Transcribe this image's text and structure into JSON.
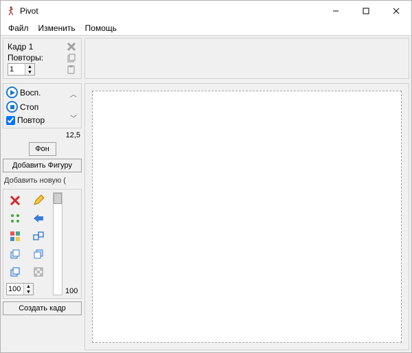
{
  "window": {
    "title": "Pivot"
  },
  "menu": {
    "file": "Файл",
    "edit": "Изменить",
    "help": "Помощь"
  },
  "frame": {
    "title": "Кадр 1",
    "repeats_label": "Повторы:",
    "repeats_value": "1"
  },
  "playback": {
    "play": "Восп.",
    "stop": "Стоп",
    "loop": "Повтор",
    "fps": "12,5"
  },
  "background_btn": "Фон",
  "add_figure_btn": "Добавить Фигуру",
  "add_new_label": "Добавить новую (",
  "scale": {
    "value": "100",
    "max_label": "100"
  },
  "create_frame_btn": "Создать кадр"
}
